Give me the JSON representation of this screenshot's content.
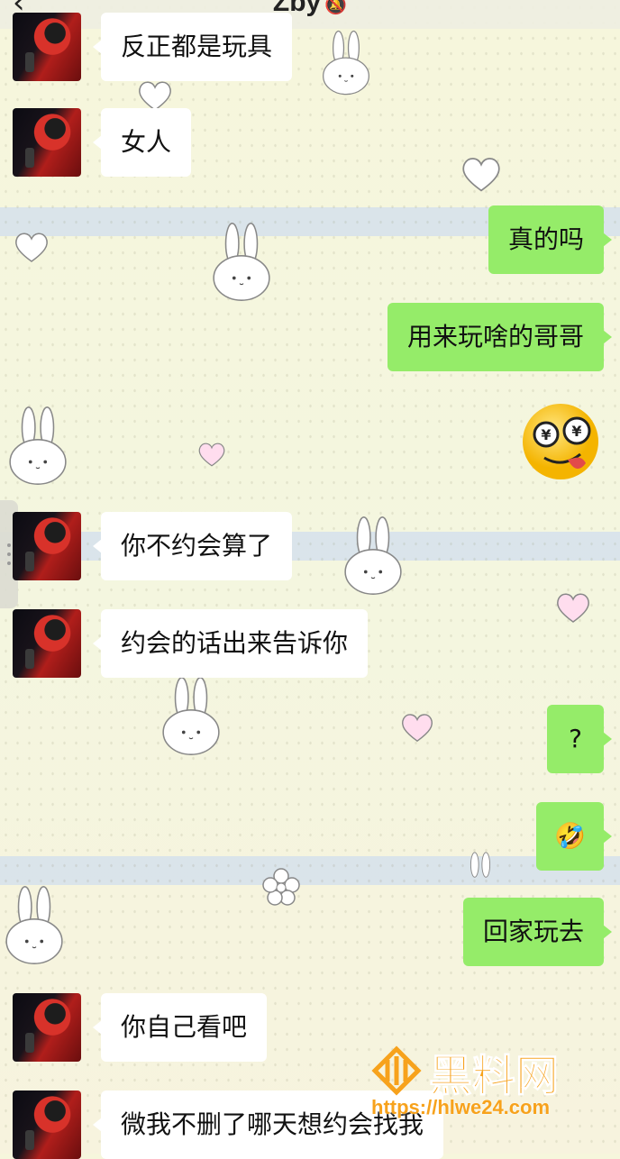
{
  "header": {
    "title": "Zby",
    "mute_icon": "bell-off-icon",
    "back_icon": "chevron-left-icon"
  },
  "messages": [
    {
      "side": "left",
      "text": "反正都是玩具"
    },
    {
      "side": "left",
      "text": "女人"
    },
    {
      "side": "right",
      "text": "真的吗"
    },
    {
      "side": "right",
      "text": "用来玩啥的哥哥"
    },
    {
      "side": "right",
      "sticker": "money-eyes-emoji"
    },
    {
      "side": "left",
      "text": "你不约会算了"
    },
    {
      "side": "left",
      "text": "约会的话出来告诉你"
    },
    {
      "side": "right",
      "text": "?"
    },
    {
      "side": "right",
      "emoji": "🤣"
    },
    {
      "side": "right",
      "text": "回家玩去"
    },
    {
      "side": "left",
      "text": "你自己看吧"
    },
    {
      "side": "left",
      "text": "微我不删了哪天想约会找我"
    }
  ],
  "watermark": {
    "name": "黑料网",
    "url": "https://hlwe24.com"
  },
  "colors": {
    "bubble_right": "#95ec69",
    "bubble_left": "#ffffff",
    "watermark": "#f7a21c"
  }
}
